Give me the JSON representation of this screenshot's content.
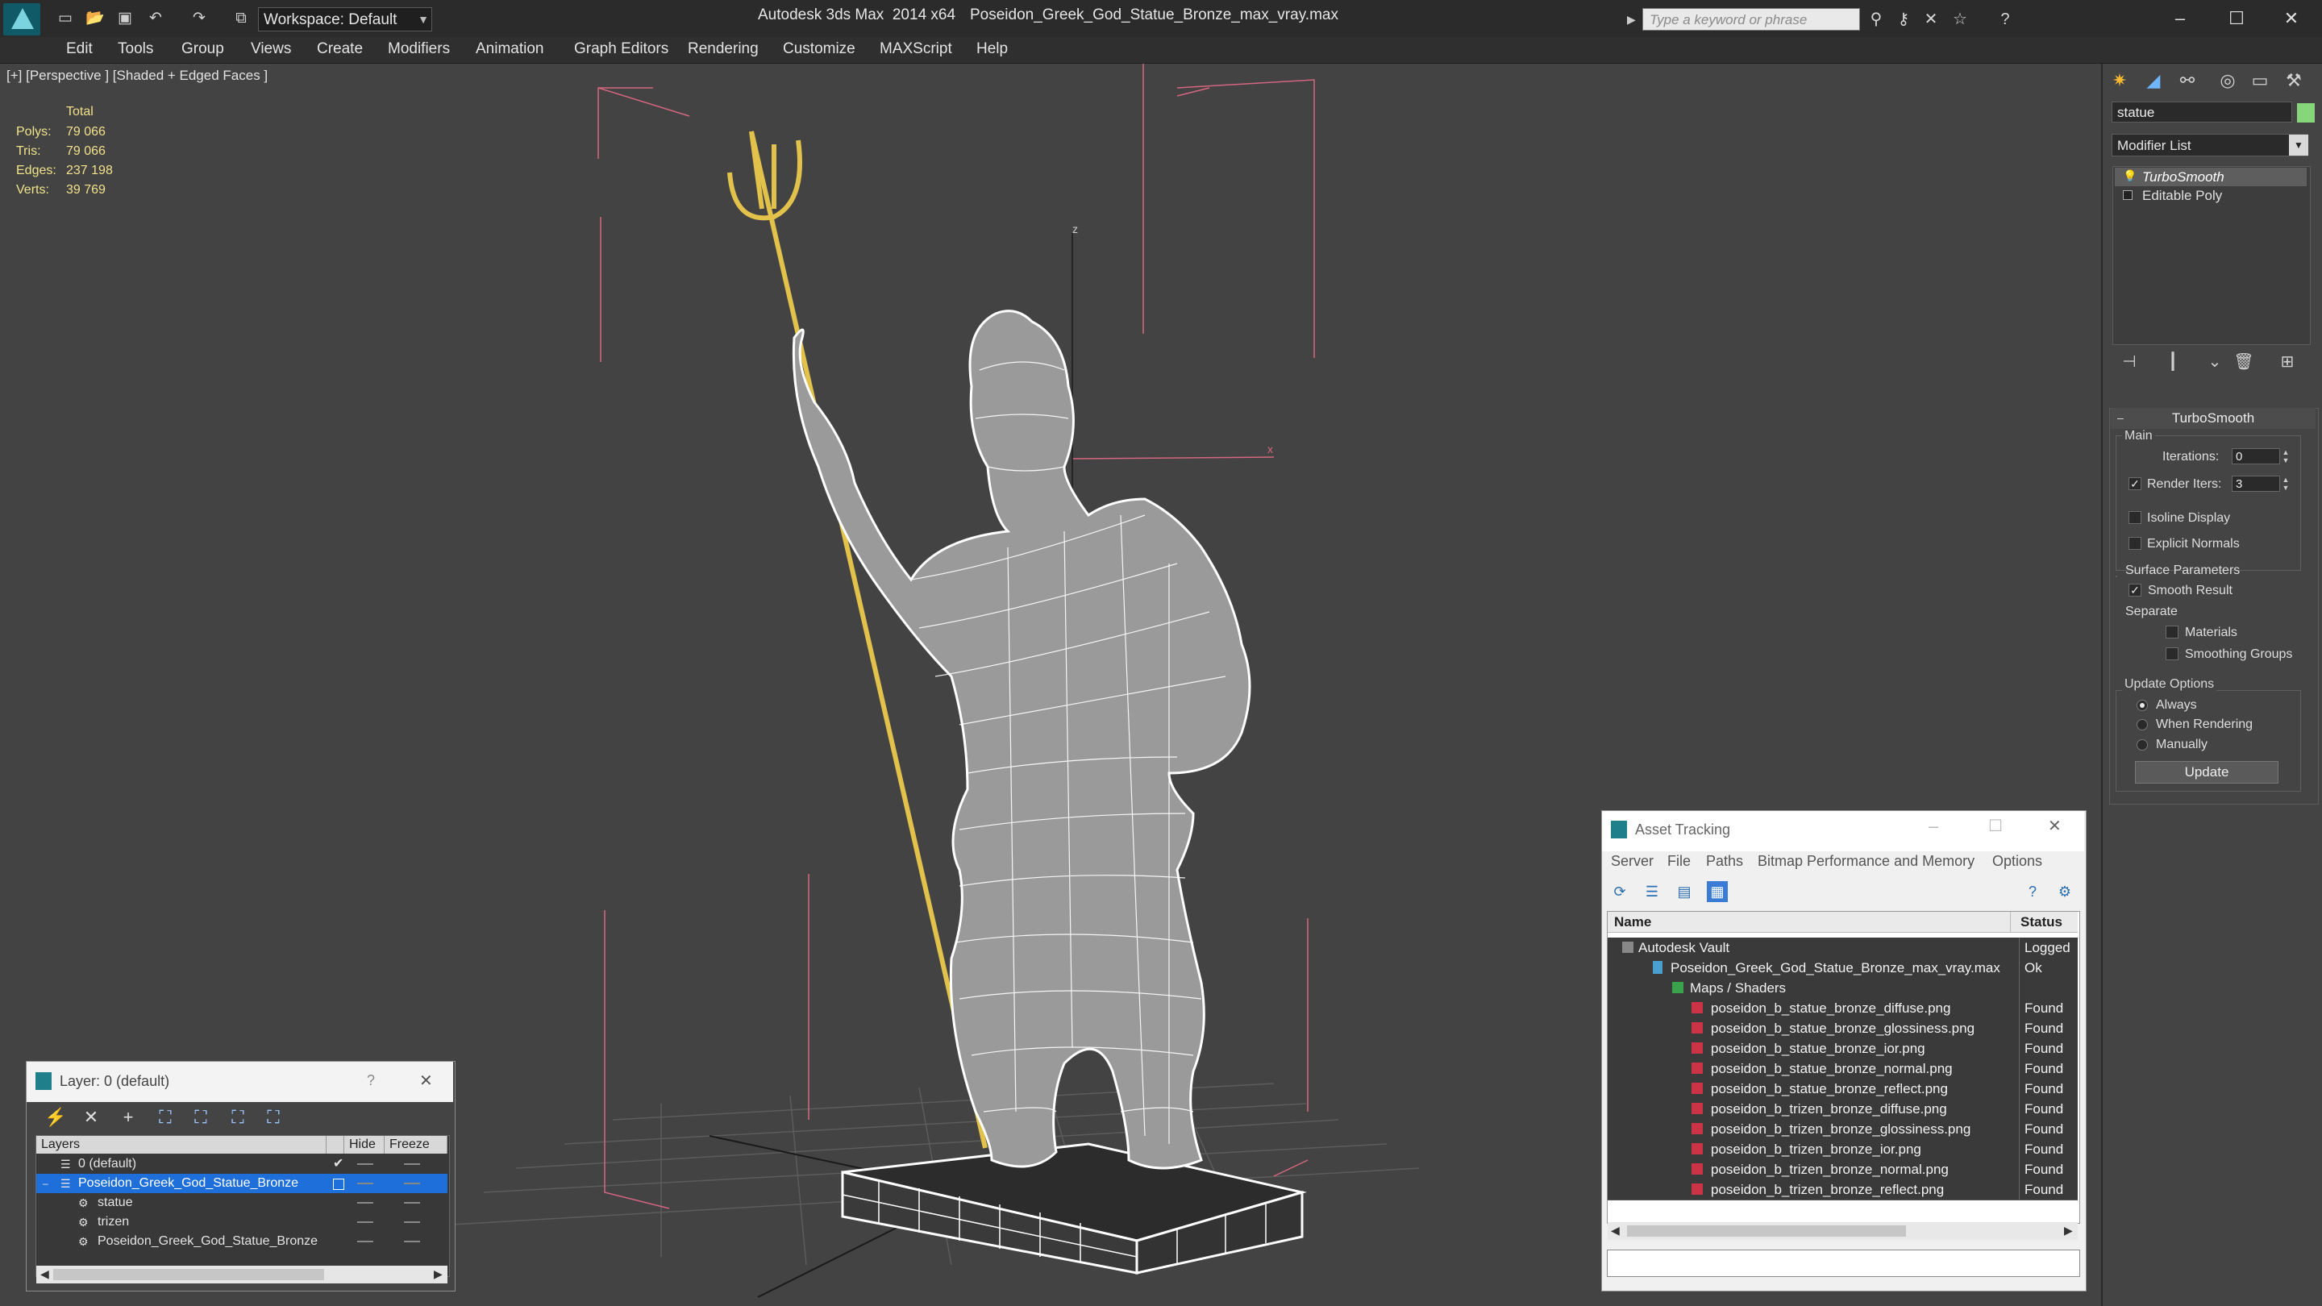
{
  "titlebar": {
    "app_title": "Autodesk 3ds Max  2014 x64",
    "file_name": "Poseidon_Greek_God_Statue_Bronze_max_vray.max",
    "workspace_label": "Workspace: Default",
    "search_placeholder": "Type a keyword or phrase"
  },
  "menu": [
    "Edit",
    "Tools",
    "Group",
    "Views",
    "Create",
    "Modifiers",
    "Animation",
    "Graph Editors",
    "Rendering",
    "Customize",
    "MAXScript",
    "Help"
  ],
  "viewport": {
    "label": "[+] [Perspective ] [Shaded + Edged Faces ]",
    "stats_header": "Total",
    "stats": [
      {
        "label": "Polys:",
        "value": "79 066"
      },
      {
        "label": "Tris:",
        "value": "79 066"
      },
      {
        "label": "Edges:",
        "value": "237 198"
      },
      {
        "label": "Verts:",
        "value": "39 769"
      }
    ],
    "axis_z": "z",
    "axis_x": "x"
  },
  "command_panel": {
    "object_name": "statue",
    "modifier_list": "Modifier List",
    "stack": [
      "TurboSmooth",
      "Editable Poly"
    ],
    "rollout_title": "TurboSmooth",
    "main_label": "Main",
    "iterations_label": "Iterations:",
    "iterations_value": "0",
    "render_iters_label": "Render Iters:",
    "render_iters_value": "3",
    "render_iters_checked": true,
    "isoline_label": "Isoline Display",
    "explicit_normals_label": "Explicit Normals",
    "surface_params_label": "Surface Parameters",
    "smooth_result_label": "Smooth Result",
    "separate_label": "Separate",
    "materials_label": "Materials",
    "smoothing_groups_label": "Smoothing Groups",
    "update_options_label": "Update Options",
    "always_label": "Always",
    "when_rendering_label": "When Rendering",
    "manually_label": "Manually",
    "update_button": "Update"
  },
  "asset_tracking": {
    "title": "Asset Tracking",
    "menu": [
      "Server",
      "File",
      "Paths",
      "Bitmap Performance and Memory",
      "Options"
    ],
    "col_name": "Name",
    "col_status": "Status",
    "rows": [
      {
        "name": "Autodesk Vault",
        "status": "Logged C"
      },
      {
        "name": "Poseidon_Greek_God_Statue_Bronze_max_vray.max",
        "status": "Ok"
      },
      {
        "name": "Maps / Shaders",
        "status": ""
      },
      {
        "name": "poseidon_b_statue_bronze_diffuse.png",
        "status": "Found"
      },
      {
        "name": "poseidon_b_statue_bronze_glossiness.png",
        "status": "Found"
      },
      {
        "name": "poseidon_b_statue_bronze_ior.png",
        "status": "Found"
      },
      {
        "name": "poseidon_b_statue_bronze_normal.png",
        "status": "Found"
      },
      {
        "name": "poseidon_b_statue_bronze_reflect.png",
        "status": "Found"
      },
      {
        "name": "poseidon_b_trizen_bronze_diffuse.png",
        "status": "Found"
      },
      {
        "name": "poseidon_b_trizen_bronze_glossiness.png",
        "status": "Found"
      },
      {
        "name": "poseidon_b_trizen_bronze_ior.png",
        "status": "Found"
      },
      {
        "name": "poseidon_b_trizen_bronze_normal.png",
        "status": "Found"
      },
      {
        "name": "poseidon_b_trizen_bronze_reflect.png",
        "status": "Found"
      }
    ]
  },
  "layer_window": {
    "title": "Layer: 0 (default)",
    "help": "?",
    "col_layers": "Layers",
    "col_hide": "Hide",
    "col_freeze": "Freeze",
    "rows": [
      "0 (default)",
      "Poseidon_Greek_God_Statue_Bronze",
      "statue",
      "trizen",
      "Poseidon_Greek_God_Statue_Bronze"
    ]
  },
  "colors": {
    "selection_blue": "#1e6fd9",
    "trident_gold": "#e2c24a",
    "bounding_pink": "#d4677f",
    "wire_white": "#ffffff"
  }
}
